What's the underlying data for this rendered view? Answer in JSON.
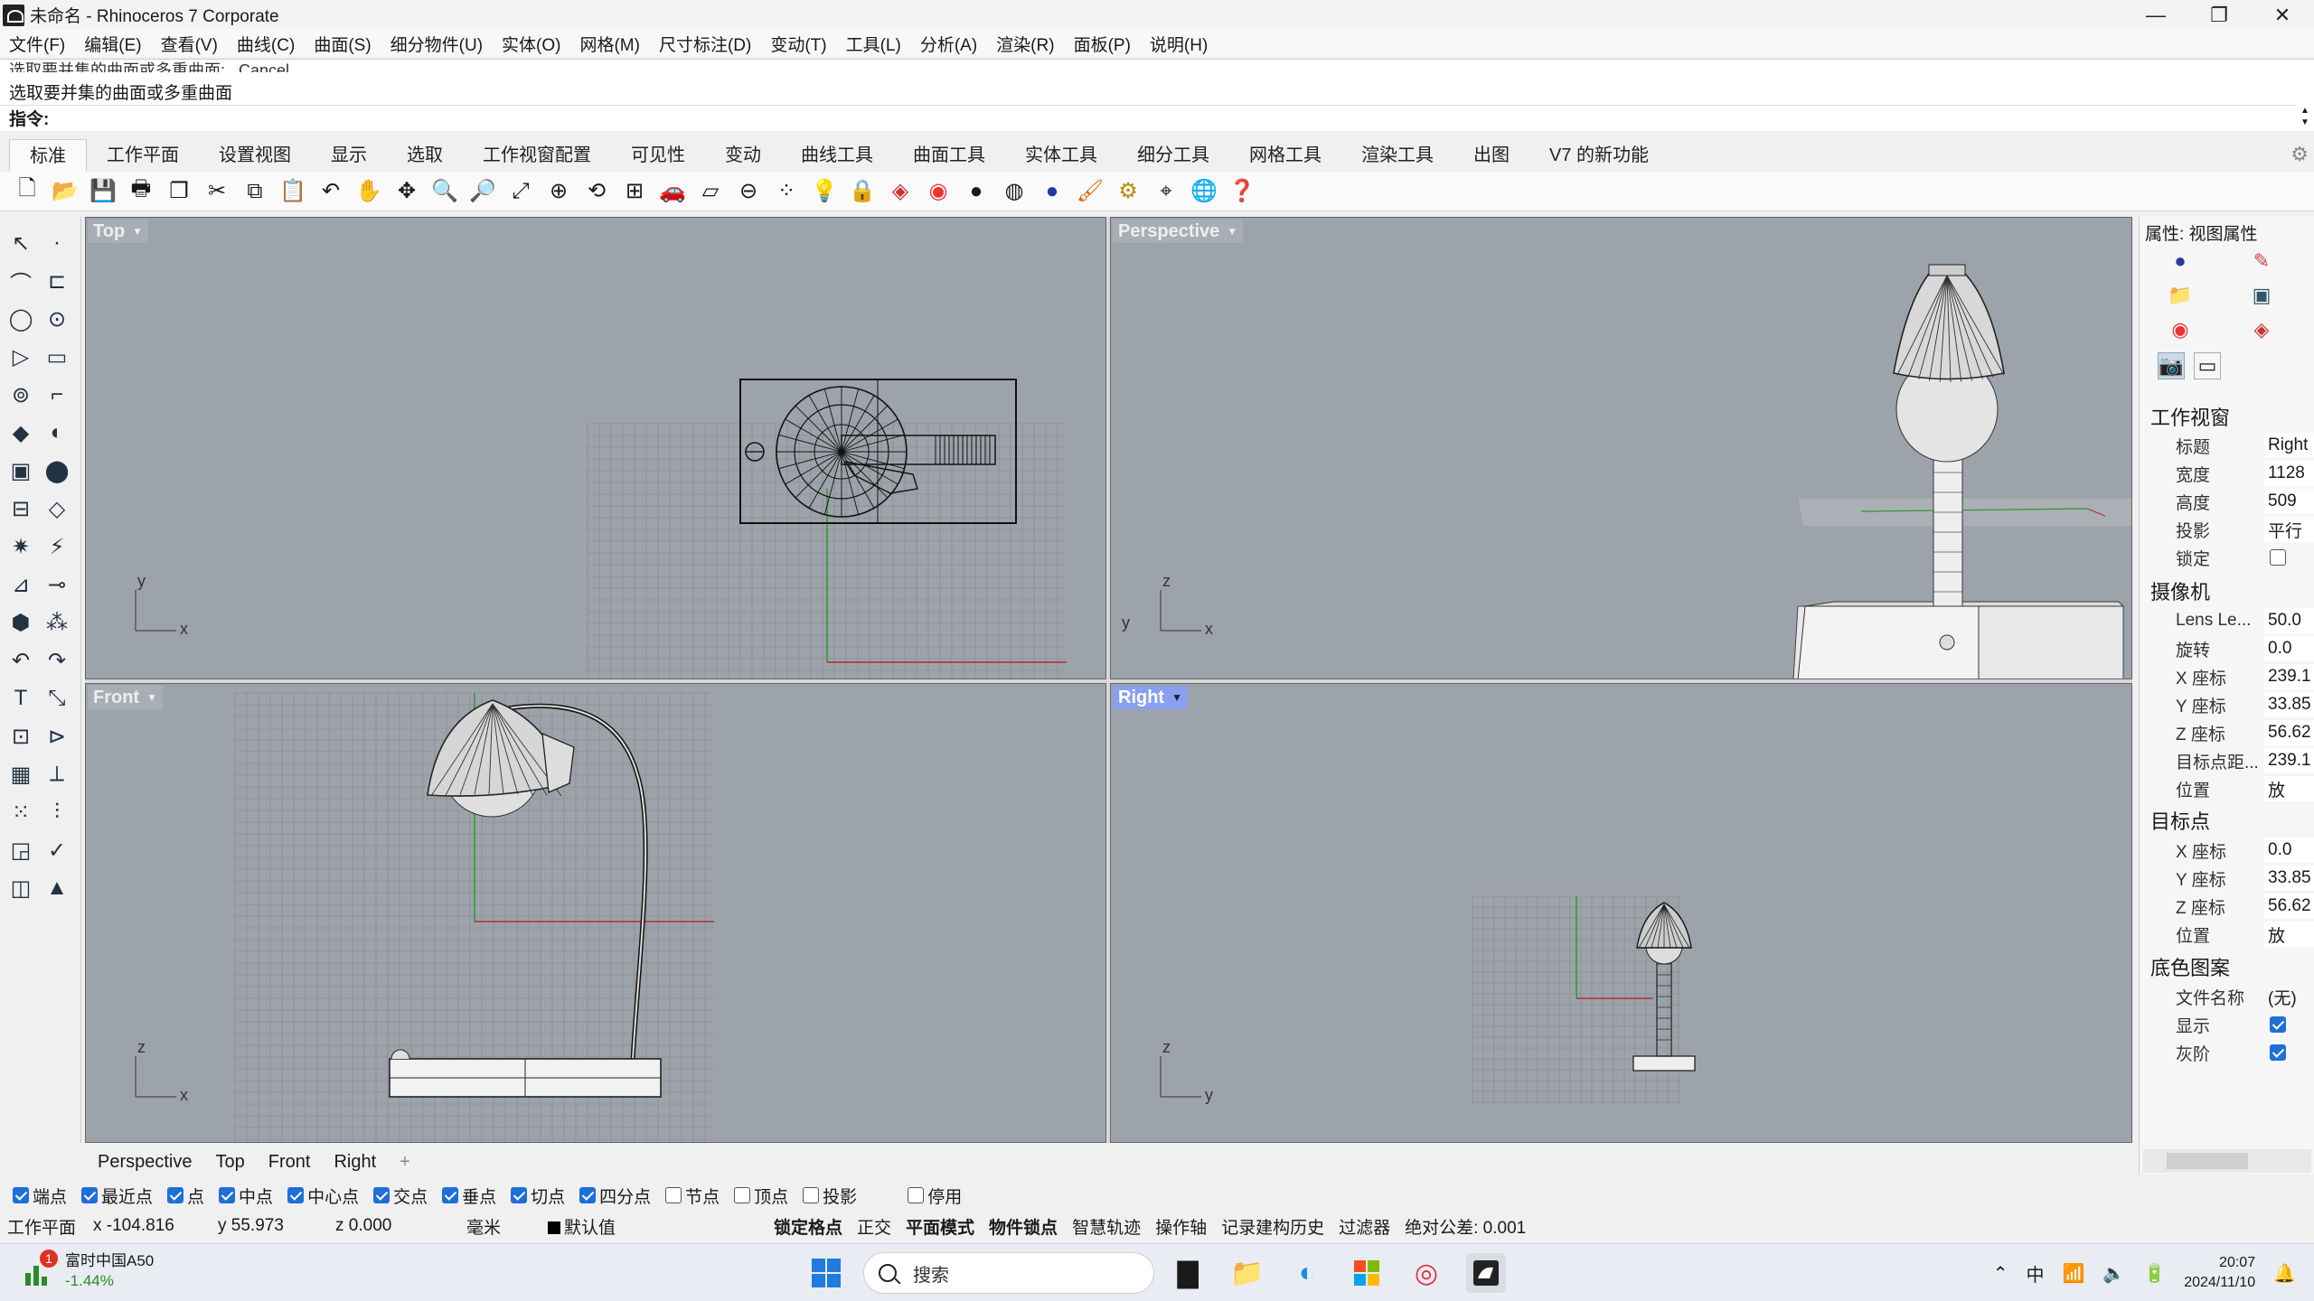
{
  "window": {
    "title": "未命名 - Rhinoceros 7 Corporate",
    "controls": {
      "minimize": "—",
      "maximize": "❐",
      "close": "✕"
    }
  },
  "menu": [
    "文件(F)",
    "编辑(E)",
    "查看(V)",
    "曲线(C)",
    "曲面(S)",
    "细分物件(U)",
    "实体(O)",
    "网格(M)",
    "尺寸标注(D)",
    "变动(T)",
    "工具(L)",
    "分析(A)",
    "渲染(R)",
    "面板(P)",
    "说明(H)"
  ],
  "command": {
    "history_1": "选取要并集的曲面或多重曲面: _Cancel",
    "history_2": "选取要并集的曲面或多重曲面",
    "prompt": "指令:",
    "value": ""
  },
  "toolbar_tabs": [
    "标准",
    "工作平面",
    "设置视图",
    "显示",
    "选取",
    "工作视窗配置",
    "可见性",
    "变动",
    "曲线工具",
    "曲面工具",
    "实体工具",
    "细分工具",
    "网格工具",
    "渲染工具",
    "出图",
    "V7 的新功能"
  ],
  "viewports": {
    "top": {
      "label": "Top"
    },
    "perspective": {
      "label": "Perspective"
    },
    "front": {
      "label": "Front"
    },
    "right": {
      "label": "Right"
    }
  },
  "axis_labels": {
    "x": "x",
    "y": "y",
    "z": "z"
  },
  "viewport_tabs": [
    "Perspective",
    "Top",
    "Front",
    "Right"
  ],
  "viewport_tab_add": "+",
  "properties": {
    "title": "属性: 视图属性",
    "section_viewport": "工作视窗",
    "viewport_rows": [
      {
        "label": "标题",
        "value": "Right"
      },
      {
        "label": "宽度",
        "value": "1128"
      },
      {
        "label": "高度",
        "value": "509"
      },
      {
        "label": "投影",
        "value": "平行"
      }
    ],
    "lock_label": "锁定",
    "section_camera": "摄像机",
    "camera_rows": [
      {
        "label": "Lens Le...",
        "value": "50.0"
      },
      {
        "label": "旋转",
        "value": "0.0"
      },
      {
        "label": "X 座标",
        "value": "239.1"
      },
      {
        "label": "Y 座标",
        "value": "33.85"
      },
      {
        "label": "Z 座标",
        "value": "56.62"
      },
      {
        "label": "目标点距...",
        "value": "239.1"
      },
      {
        "label": "位置",
        "value": "放"
      }
    ],
    "section_target": "目标点",
    "target_rows": [
      {
        "label": "X 座标",
        "value": "0.0"
      },
      {
        "label": "Y 座标",
        "value": "33.85"
      },
      {
        "label": "Z 座标",
        "value": "56.62"
      },
      {
        "label": "位置",
        "value": "放"
      }
    ],
    "section_wallpaper": "底色图案",
    "wallpaper_file_label": "文件名称",
    "wallpaper_file_value": "(无)",
    "show_label": "显示",
    "gray_label": "灰阶"
  },
  "osnaps": [
    {
      "label": "端点",
      "checked": true
    },
    {
      "label": "最近点",
      "checked": true
    },
    {
      "label": "点",
      "checked": true
    },
    {
      "label": "中点",
      "checked": true
    },
    {
      "label": "中心点",
      "checked": true
    },
    {
      "label": "交点",
      "checked": true
    },
    {
      "label": "垂点",
      "checked": true
    },
    {
      "label": "切点",
      "checked": true
    },
    {
      "label": "四分点",
      "checked": true
    },
    {
      "label": "节点",
      "checked": false
    },
    {
      "label": "顶点",
      "checked": false
    },
    {
      "label": "投影",
      "checked": false
    },
    {
      "label": "停用",
      "checked": false
    }
  ],
  "status": {
    "cplane": "工作平面",
    "x": "x -104.816",
    "y": "y 55.973",
    "z": "z 0.000",
    "units": "毫米",
    "layer": "默认值",
    "grid_snap": "锁定格点",
    "ortho": "正交",
    "planar": "平面模式",
    "osnap": "物件锁点",
    "smarttrack": "智慧轨迹",
    "gumball": "操作轴",
    "history": "记录建构历史",
    "filter": "过滤器",
    "tolerance": "绝对公差: 0.001"
  },
  "taskbar": {
    "stock_name": "富时中国A50",
    "stock_change": "-1.44%",
    "stock_badge": "1",
    "search_placeholder": "搜索",
    "ime": "中",
    "time": "20:07",
    "date": "2024/11/10"
  },
  "colors": {
    "viewport_bg": "#9ca3ab",
    "active_label": "#8b9ff0",
    "x_axis": "#b03030",
    "y_axis": "#2a9a2a",
    "checkbox": "#1f6fd8"
  }
}
